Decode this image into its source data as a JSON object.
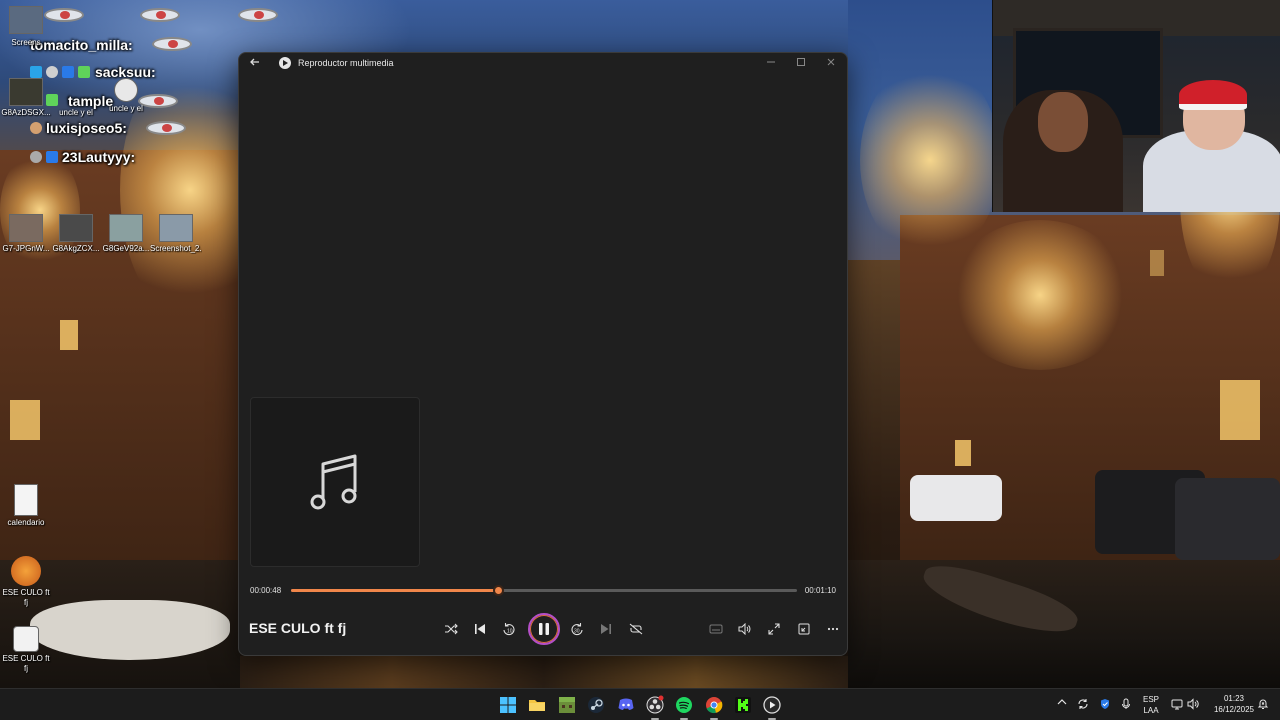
{
  "wallpaper": {
    "name": "amsterdam-canal-christmas"
  },
  "chat": [
    {
      "user": "tomacito_milla:",
      "color": "#ffffff"
    },
    {
      "user": "sacksuu:",
      "color": "#ffffff"
    },
    {
      "user": "tample",
      "color": "#ffffff"
    },
    {
      "user": "luxisjoseo5:",
      "color": "#ffffff"
    },
    {
      "user": "23Lautyyy:",
      "color": "#ffffff"
    }
  ],
  "desktop_icons": [
    {
      "label": "Screens"
    },
    {
      "label": "G8AzDSGX..."
    },
    {
      "label": "uncle y el"
    },
    {
      "label": "uncle y el"
    },
    {
      "label": "G7-JPGnW..."
    },
    {
      "label": "G8AkgZCX..."
    },
    {
      "label": "G8GeV92a..."
    },
    {
      "label": "Screenshot_2..."
    },
    {
      "label": "calendario"
    },
    {
      "label": "ESE CULO ft fj"
    },
    {
      "label": "ESE CULO ft fj"
    }
  ],
  "player": {
    "app_title": "Reproductor multimedia",
    "track_title": "ESE CULO ft fj",
    "time_current": "00:00:48",
    "time_total": "00:01:10",
    "progress": 0.41,
    "accent": "#f0864a",
    "play_ring": "#b44fc8",
    "controls": [
      "shuffle-icon",
      "previous-icon",
      "rewind-10-icon",
      "pause-icon",
      "forward-30-icon",
      "next-icon",
      "repeat-off-icon",
      "captions-icon",
      "volume-icon",
      "fullscreen-icon",
      "miniplayer-icon",
      "more-icon"
    ]
  },
  "taskbar": {
    "apps": [
      "windows-start-icon",
      "file-explorer-icon",
      "minecraft-icon",
      "steam-icon",
      "discord-icon",
      "obs-icon",
      "spotify-icon",
      "chrome-icon",
      "kick-icon",
      "media-player-icon"
    ],
    "language": {
      "line1": "ESP",
      "line2": "LAA"
    },
    "time": "01:23",
    "date": "16/12/2025"
  }
}
